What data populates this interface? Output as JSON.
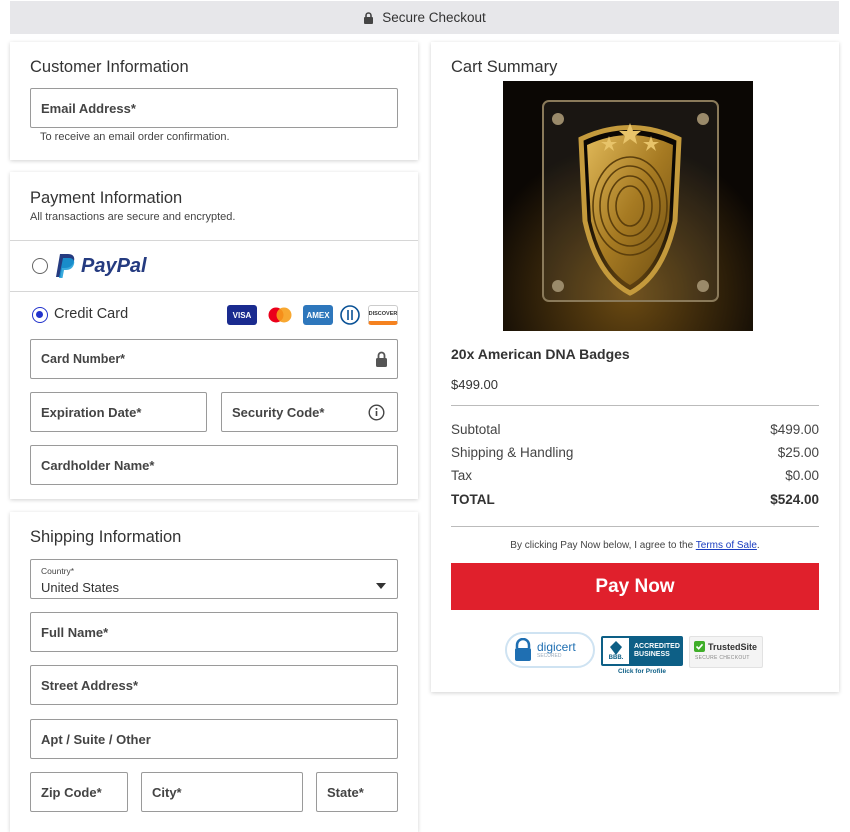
{
  "topbar": {
    "label": "Secure Checkout"
  },
  "customer": {
    "title": "Customer Information",
    "email_label": "Email Address*",
    "email_hint": "To receive an email order confirmation."
  },
  "payment": {
    "title": "Payment Information",
    "subtitle": "All transactions are secure and encrypted.",
    "paypal_label": "PayPal",
    "credit_label": "Credit Card",
    "cards": [
      "VISA",
      "MC",
      "AMEX",
      "DC",
      "DISCOVER"
    ],
    "card_number_label": "Card Number*",
    "expiration_label": "Expiration Date*",
    "security_label": "Security Code*",
    "cardholder_label": "Cardholder Name*"
  },
  "shipping": {
    "title": "Shipping Information",
    "country_label": "Country*",
    "country_value": "United States",
    "full_name_label": "Full Name*",
    "street_label": "Street Address*",
    "apt_label": "Apt / Suite / Other",
    "zip_label": "Zip Code*",
    "city_label": "City*",
    "state_label": "State*"
  },
  "cart": {
    "title": "Cart Summary",
    "product_name": "20x American DNA Badges",
    "product_price": "$499.00",
    "subtotal_label": "Subtotal",
    "subtotal_value": "$499.00",
    "shipping_label": "Shipping & Handling",
    "shipping_value": "$25.00",
    "tax_label": "Tax",
    "tax_value": "$0.00",
    "total_label": "TOTAL",
    "total_value": "$524.00",
    "terms_prefix": "By clicking Pay Now below, I agree to the ",
    "terms_link": "Terms of Sale",
    "terms_suffix": ".",
    "pay_button": "Pay Now",
    "badges": {
      "digicert": "digicert",
      "digicert_sub": "SECURED",
      "bbb_line1": "ACCREDITED",
      "bbb_line2": "BUSINESS",
      "bbb_mark": "BBB.",
      "bbb_click": "Click for Profile",
      "trusted": "TrustedSite",
      "trusted_sub": "SECURE CHECKOUT"
    }
  },
  "colors": {
    "accent": "#e0202c",
    "radio": "#2233cc",
    "link": "#1a3dbf"
  }
}
